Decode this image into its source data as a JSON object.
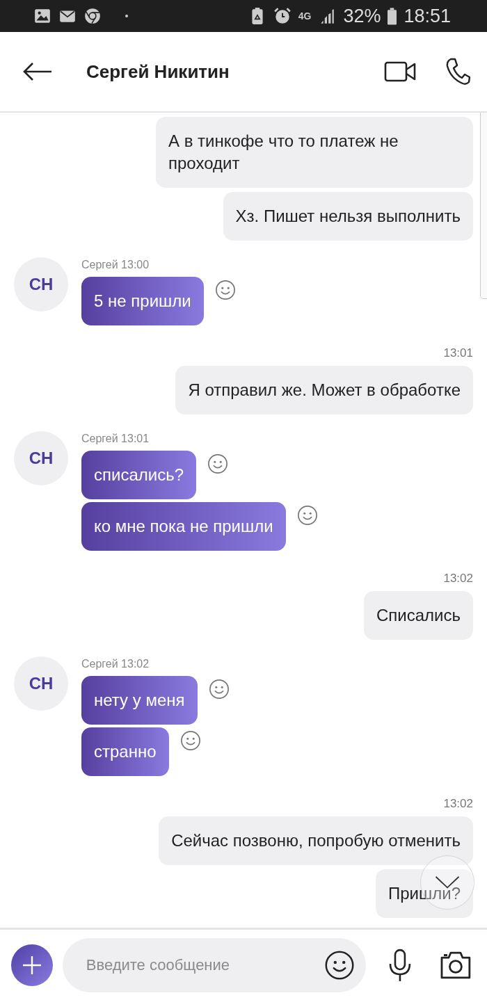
{
  "status_bar": {
    "network": "4G",
    "battery": "32%",
    "time": "18:51"
  },
  "header": {
    "title": "Сергей Никитин"
  },
  "messages": [
    {
      "kind": "out",
      "text": "А в тинкофе что то платеж не проходит"
    },
    {
      "kind": "out",
      "text": "Хз. Пишет нельзя выполнить"
    },
    {
      "kind": "in",
      "avatar": "СН",
      "meta": "Сергей 13:00",
      "bubbles": [
        "5 не пришли"
      ]
    },
    {
      "kind": "time",
      "text": "13:01"
    },
    {
      "kind": "out",
      "text": "Я отправил же. Может в обработке"
    },
    {
      "kind": "in",
      "avatar": "СН",
      "meta": "Сергей 13:01",
      "bubbles": [
        "списались?",
        "ко мне пока не пришли"
      ]
    },
    {
      "kind": "time",
      "text": "13:02"
    },
    {
      "kind": "out",
      "text": "Списались"
    },
    {
      "kind": "in",
      "avatar": "СН",
      "meta": "Сергей 13:02",
      "bubbles": [
        "нету у меня",
        "странно"
      ]
    },
    {
      "kind": "time",
      "text": "13:02"
    },
    {
      "kind": "out",
      "text": "Сейчас позвоню, попробую отменить"
    },
    {
      "kind": "out",
      "text": "Пришли?"
    }
  ],
  "composer": {
    "placeholder": "Введите сообщение"
  }
}
